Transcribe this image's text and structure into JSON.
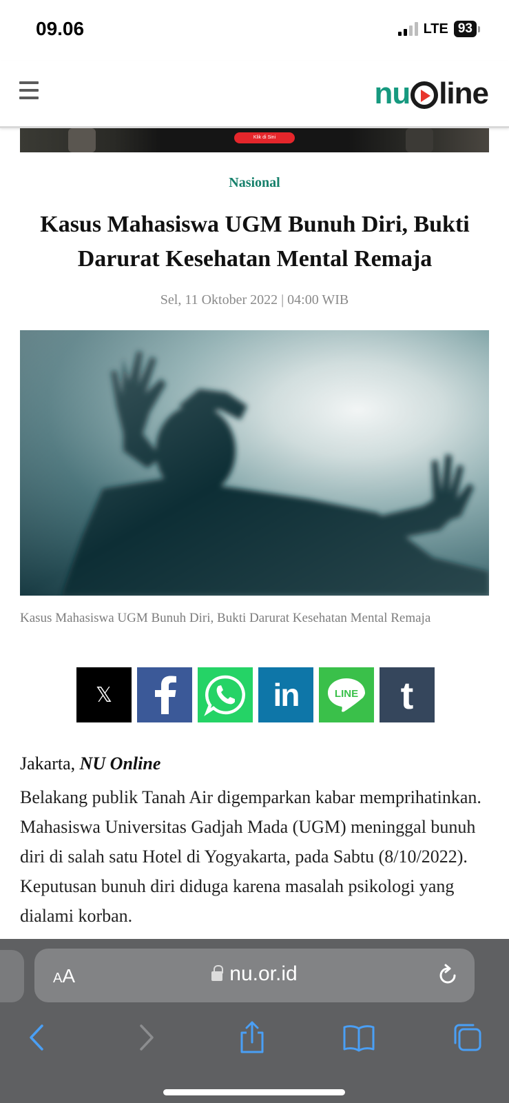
{
  "status": {
    "time": "09.06",
    "network": "LTE",
    "battery": "93"
  },
  "header": {
    "logo_prefix": "nu",
    "logo_suffix": "line"
  },
  "ad": {
    "cta": "Klik di Sini"
  },
  "article": {
    "category": "Nasional",
    "title": "Kasus Mahasiswa UGM Bunuh Diri, Bukti Darurat Kesehatan Mental Remaja",
    "date": "Sel, 11 Oktober 2022 | 04:00 WIB",
    "caption": "Kasus Mahasiswa UGM Bunuh Diri, Bukti Darurat Kesehatan Mental Remaja",
    "dateline_place": "Jakarta, ",
    "dateline_source": "NU Online",
    "body": "Belakang publik Tanah Air digemparkan kabar memprihatinkan. Mahasiswa Universitas Gadjah Mada (UGM) meninggal bunuh diri di salah satu Hotel di Yogyakarta, pada Sabtu (8/10/2022). Keputusan bunuh diri diduga karena masalah psikologi yang dialami korban."
  },
  "share": {
    "x_glyph": "𝕏",
    "linkedin_label": "in",
    "line_label": "LINE",
    "tumblr_label": "t"
  },
  "browser": {
    "text_size_label_small": "A",
    "text_size_label_large": "A",
    "url": "nu.or.id"
  },
  "colors": {
    "brand_green": "#16997f",
    "category_green": "#16806b",
    "safari_accent": "#4a9ff5",
    "safari_disabled": "#8c8d8f"
  }
}
